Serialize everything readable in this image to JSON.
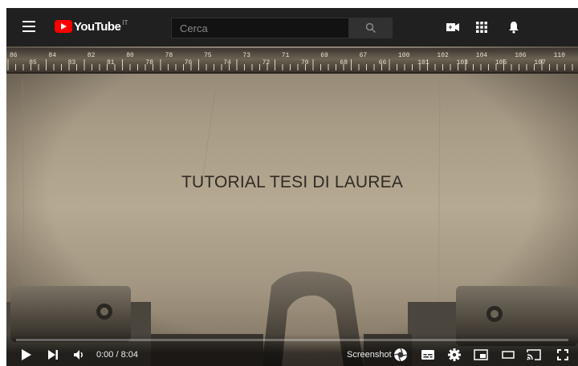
{
  "header": {
    "logo_text": "YouTube",
    "country_code": "IT",
    "search_placeholder": "Cerca"
  },
  "video": {
    "title_text": "TUTORIAL TESI DI LAUREA",
    "ruler_numbers": [
      "86",
      "85",
      "84",
      "83",
      "82",
      "81",
      "80",
      "78",
      "78",
      "76",
      "75",
      "74",
      "73",
      "72",
      "71",
      "70",
      "69",
      "68",
      "67",
      "66",
      "100",
      "101",
      "102",
      "103",
      "104",
      "105",
      "106",
      "107",
      "110"
    ]
  },
  "player": {
    "time": "0:00 / 8:04",
    "screenshot_label": "Screenshot",
    "progress": 0
  },
  "icons": {
    "menu": "hamburger-icon",
    "search": "search-icon",
    "create": "video-camera-plus-icon",
    "apps": "apps-grid-icon",
    "notifications": "bell-icon",
    "play": "play-icon",
    "next": "next-icon",
    "volume": "volume-icon",
    "screenshot": "camera-shutter-icon",
    "subtitles": "subtitles-icon",
    "settings": "gear-icon",
    "miniplayer": "miniplayer-icon",
    "theater": "theater-icon",
    "cast": "cast-icon",
    "fullscreen": "fullscreen-icon"
  },
  "colors": {
    "brand_red": "#ff0000",
    "topbar_bg": "#202020"
  }
}
